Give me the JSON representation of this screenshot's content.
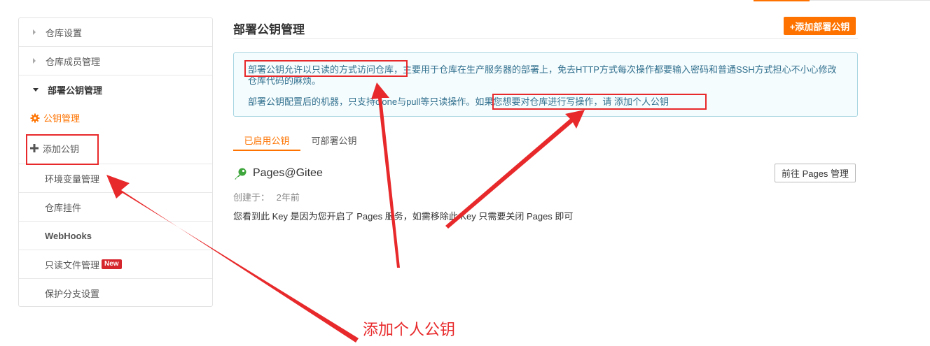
{
  "sidebar": {
    "items": [
      {
        "label": "仓库设置"
      },
      {
        "label": "仓库成员管理"
      },
      {
        "label": "部署公钥管理"
      },
      {
        "label": "公钥管理"
      },
      {
        "label": "添加公钥"
      },
      {
        "label": "环境变量管理"
      },
      {
        "label": "仓库挂件"
      },
      {
        "label": "WebHooks"
      },
      {
        "label": "只读文件管理",
        "badge": "New"
      },
      {
        "label": "保护分支设置"
      }
    ]
  },
  "main": {
    "title": "部署公钥管理",
    "add_button": "+添加部署公钥",
    "info": {
      "p1_highlight": "部署公钥允许以只读的方式访问仓库",
      "p1_rest": "，主要用于仓库在生产服务器的部署上，免去HTTP方式每次操作都要输入密码和普通SSH方式担心不小心修改仓库代码的麻烦。",
      "p2_start": "部署公钥配置后的机器，只支持clone与pull等只读操作。",
      "p2_highlight": "如果您想要对仓库进行写操作，请 添加个人公钥"
    },
    "tabs": [
      {
        "label": "已启用公钥"
      },
      {
        "label": "可部署公钥"
      }
    ],
    "key": {
      "name": "Pages@Gitee",
      "created_label": "创建于：",
      "created_value": "2年前",
      "goto_button": "前往 Pages 管理",
      "description": "您看到此 Key 是因为您开启了 Pages 服务，如需移除此 Key 只需要关闭 Pages 即可"
    }
  },
  "annotation": "添加个人公钥",
  "colors": {
    "accent": "#fe7300",
    "annotation_red": "#e8292b",
    "info_text": "#31708f",
    "info_bg": "#f5fcfd"
  }
}
